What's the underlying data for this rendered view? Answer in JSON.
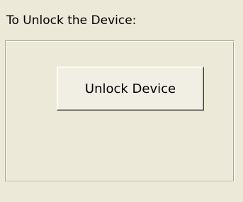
{
  "unlock_section": {
    "label": "To Unlock the Device:",
    "button_label": "Unlock Device"
  },
  "colors": {
    "background": "#ece9d8",
    "button_face": "#f1efe4",
    "border_shadow": "#a6a593",
    "border_highlight": "#ffffff"
  }
}
